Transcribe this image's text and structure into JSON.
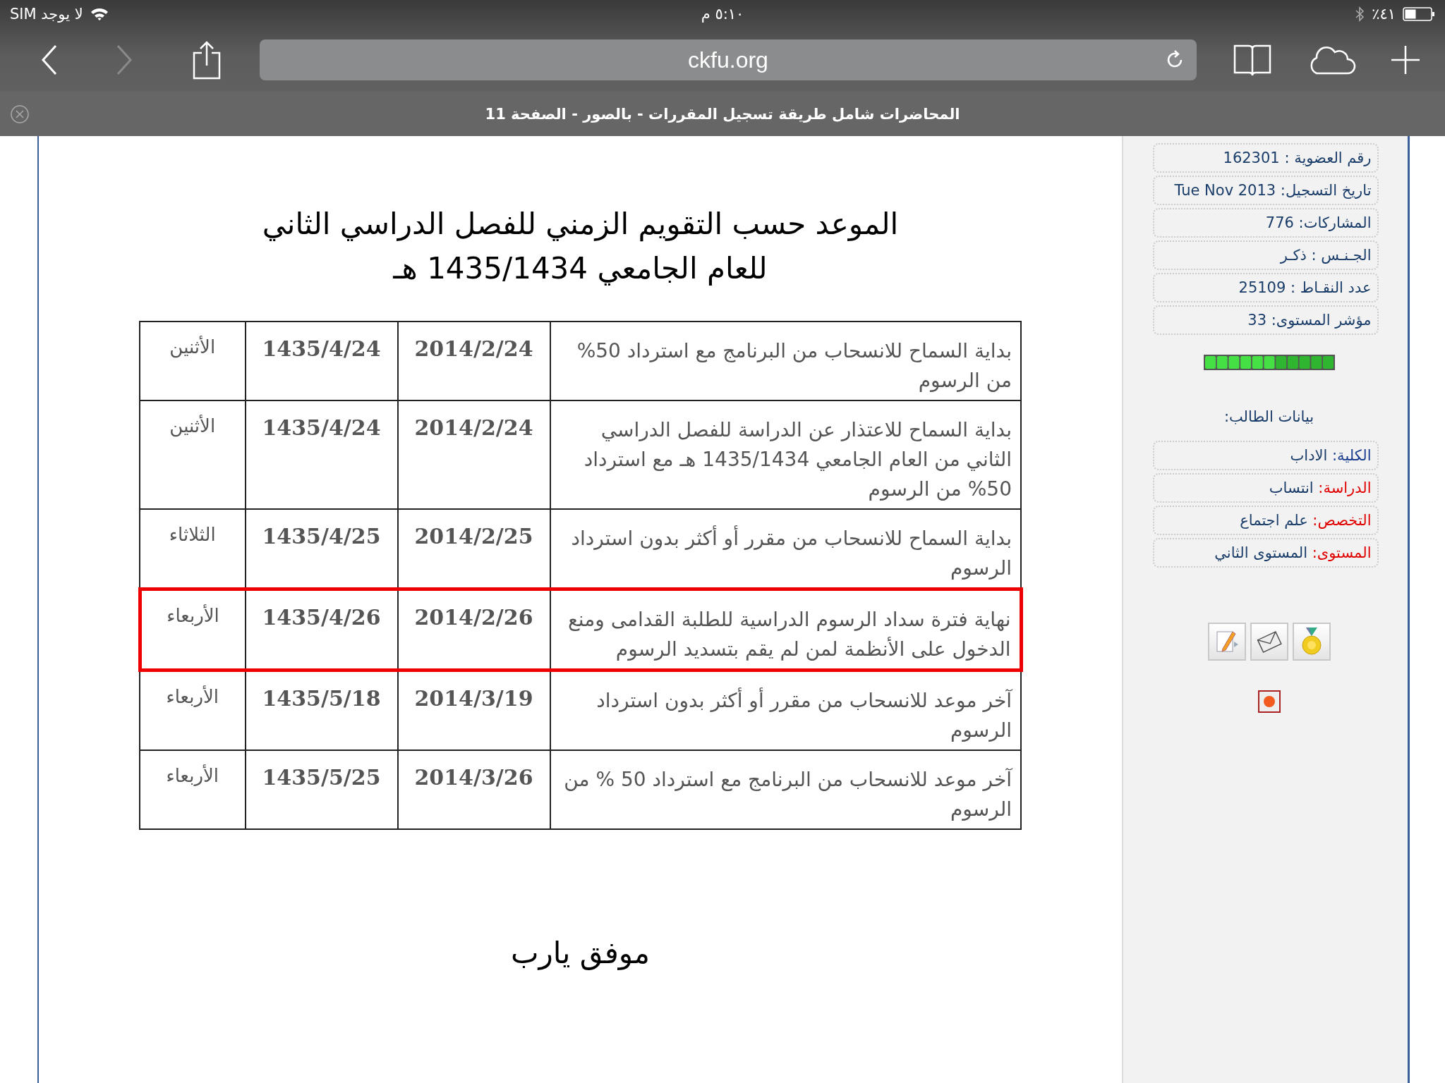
{
  "status_bar": {
    "carrier": "لا يوجد SIM",
    "time": "٥:١٠ م",
    "battery_text": "٪٤١"
  },
  "toolbar": {
    "back": {
      "disabled": false
    },
    "forward": {
      "disabled": true
    },
    "url": "ckfu.org"
  },
  "tab": {
    "title": "المحاضرات شامل طريقة تسجيل المقررات - بالصور - الصفحة 11"
  },
  "post": {
    "heading": [
      "الموعد حسب التقويم الزمني للفصل الدراسي الثاني",
      "للعام الجامعي 1435/1434 هـ"
    ],
    "table": {
      "rows": [
        {
          "description": "بداية السماح للانسحاب من البرنامج مع استرداد 50% من الرسوم",
          "gregorian": "2014/2/24",
          "hijri": "1435/4/24",
          "day": "الأثنين",
          "highlighted": false
        },
        {
          "description": "بداية السماح للاعتذار عن الدراسة للفصل الدراسي الثاني من العام الجامعي 1435/1434 هـ مع استرداد 50% من الرسوم",
          "gregorian": "2014/2/24",
          "hijri": "1435/4/24",
          "day": "الأثنين",
          "highlighted": false
        },
        {
          "description": "بداية السماح للانسحاب من مقرر أو أكثر بدون استرداد الرسوم",
          "gregorian": "2014/2/25",
          "hijri": "1435/4/25",
          "day": "الثلاثاء",
          "highlighted": false
        },
        {
          "description": "نهاية فترة سداد الرسوم الدراسية للطلبة القدامى ومنع الدخول على الأنظمة لمن لم يقم بتسديد الرسوم",
          "gregorian": "2014/2/26",
          "hijri": "1435/4/26",
          "day": "الأربعاء",
          "highlighted": true
        },
        {
          "description": "آخر موعد للانسحاب من مقرر أو أكثر بدون استرداد الرسوم",
          "gregorian": "2014/3/19",
          "hijri": "1435/5/18",
          "day": "الأربعاء",
          "highlighted": false
        },
        {
          "description": "آخر موعد للانسحاب من البرنامج مع استرداد 50 % من الرسوم",
          "gregorian": "2014/3/26",
          "hijri": "1435/5/25",
          "day": "الأربعاء",
          "highlighted": false
        }
      ]
    },
    "closing": "موفق يارب"
  },
  "sidebar": {
    "user_info": [
      "رقم العضوية : 162301",
      "تاريخ التسجيل: Tue Nov 2013",
      "المشاركات: 776",
      "الجـنـس : ذكـر",
      "عدد النقـاط : 25109",
      "مؤشر المستوى: 33"
    ],
    "student_title": "بيانات الطالب:",
    "student_info": [
      {
        "label": "الكلية:",
        "value": "الاداب",
        "color": "#1a3d8f"
      },
      {
        "label": "الدراسة:",
        "value": "انتساب",
        "color": "#e00000"
      },
      {
        "label": "التخصص:",
        "value": "علم اجتماع",
        "color": "#e00000"
      },
      {
        "label": "المستوى:",
        "value": "المستوى الثاني",
        "color": "#e00000"
      }
    ]
  }
}
